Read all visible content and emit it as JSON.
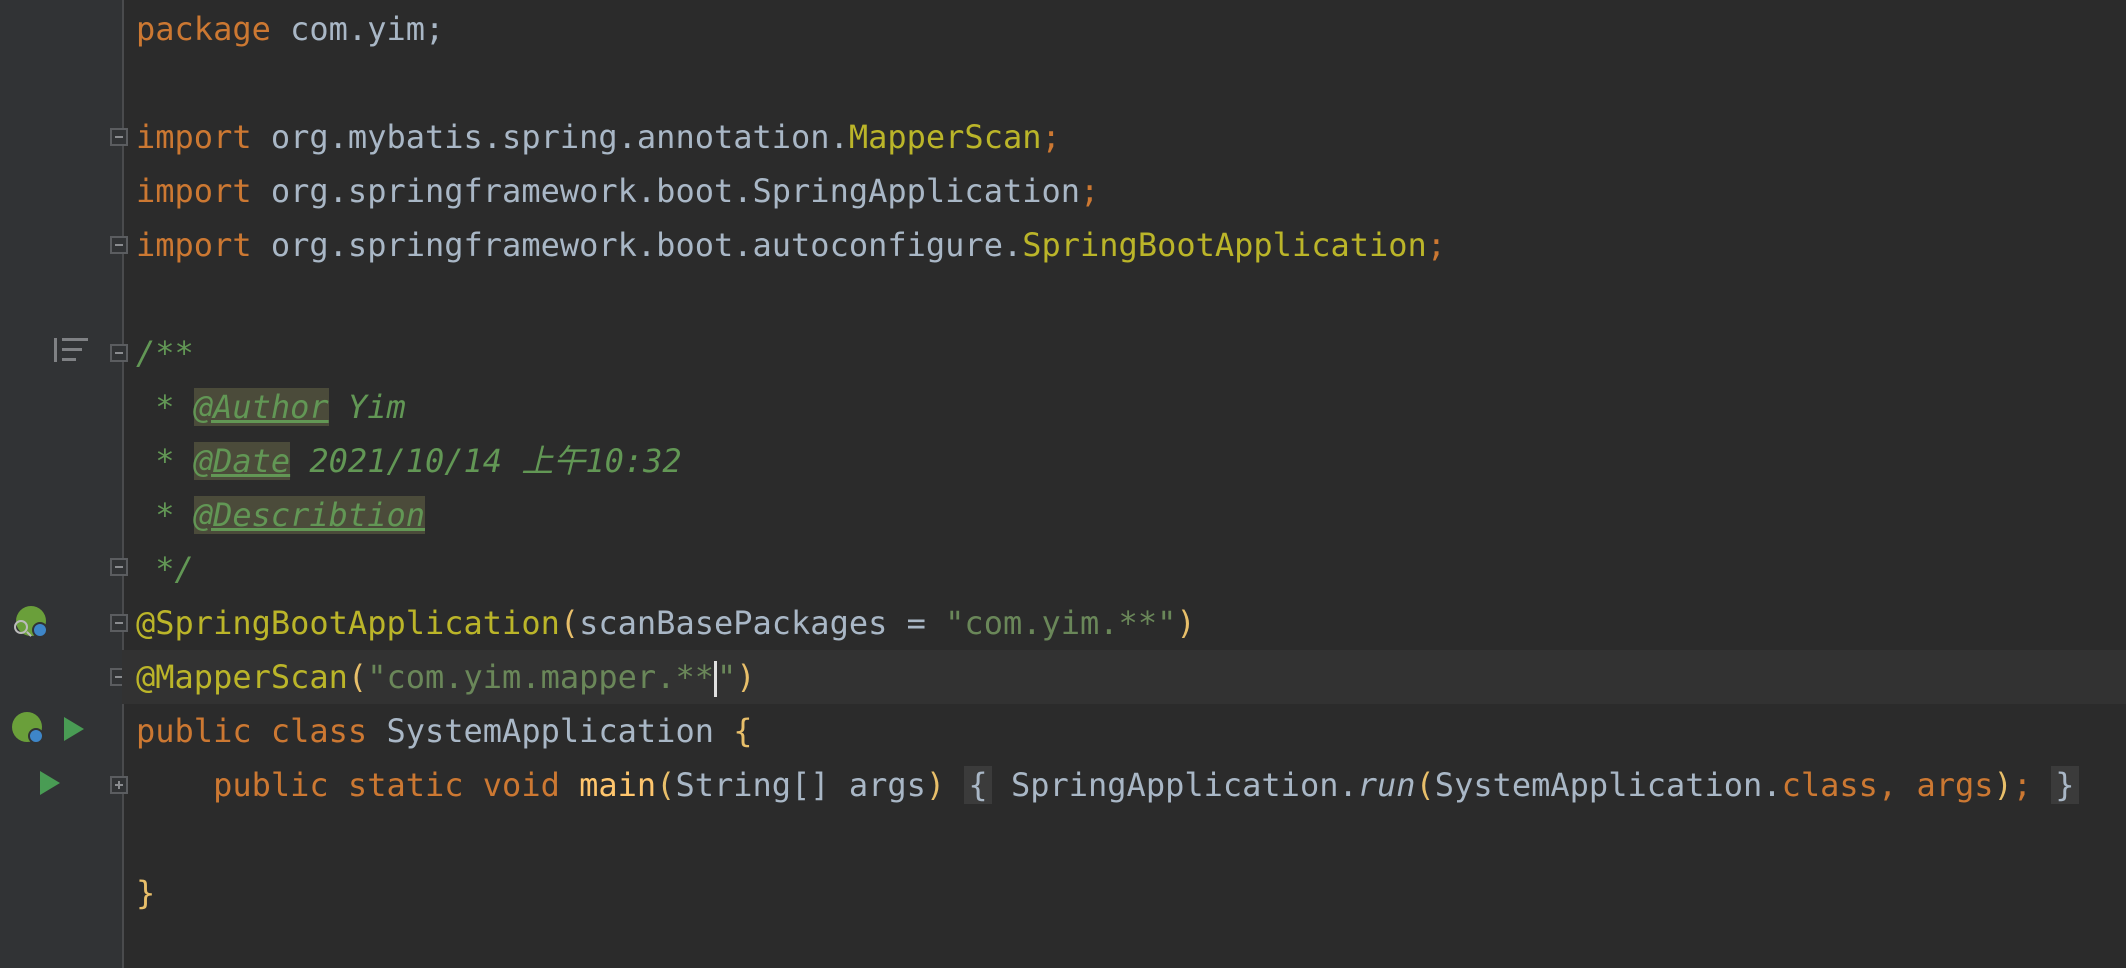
{
  "editor": {
    "line1": {
      "kw_package": "package",
      "text": " com.yim;"
    },
    "line3": {
      "kw_import": "import",
      "path": " org.mybatis.spring.annotation.",
      "cls": "MapperScan",
      "semi": ";"
    },
    "line4": {
      "kw_import": "import",
      "path": " org.springframework.boot.SpringApplication",
      "semi": ";"
    },
    "line5": {
      "kw_import": "import",
      "path": " org.springframework.boot.autoconfigure.",
      "cls": "SpringBootApplication",
      "semi": ";"
    },
    "comment": {
      "open": "/**",
      "star": " * ",
      "author_tag": "@Author",
      "author_value": " Yim",
      "date_tag": "@Date",
      "date_value": " 2021/10/14 上午10:32",
      "desc_tag": "@Describtion",
      "close": " */"
    },
    "ann1": {
      "name": "@SpringBootApplication",
      "open": "(",
      "param": "scanBasePackages = ",
      "value": "\"com.yim.**\"",
      "close": ")"
    },
    "ann2": {
      "name": "@MapperScan",
      "open": "(",
      "value_before_caret": "\"com.yim.mapper.**",
      "value_after_caret": "\"",
      "close": ")"
    },
    "class_decl": {
      "kw_public": "public",
      "kw_class": "class",
      "name": "SystemApplication",
      "brace": "{"
    },
    "main_method": {
      "indent": "    ",
      "kw_public": "public",
      "kw_static": "static",
      "kw_void": "void",
      "name": "main",
      "open": "(",
      "params": "String[] args",
      "close": ")",
      "fold_open": "{",
      "call_target": "SpringApplication.",
      "call_name": "run",
      "call_open": "(",
      "call_arg1": "SystemApplication.",
      "kw_class": "class",
      "call_arg2": ", args",
      "call_close": ")",
      "semi": ";",
      "fold_close": "}"
    },
    "class_close": "}"
  }
}
